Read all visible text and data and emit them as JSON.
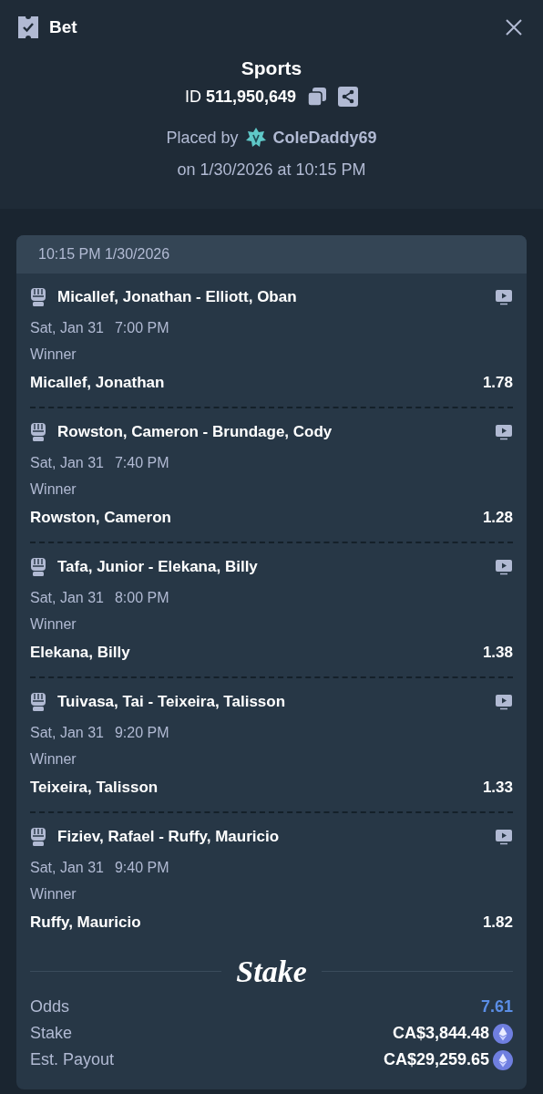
{
  "header": {
    "title": "Bet"
  },
  "bet": {
    "category": "Sports",
    "id_label": "ID",
    "id": "511,950,649",
    "placed_by": "Placed by",
    "user": "ColeDaddy69",
    "placed_on": "on 1/30/2026 at 10:15 PM"
  },
  "slip": {
    "timestamp": "10:15 PM 1/30/2026",
    "legs": [
      {
        "event": "Micallef, Jonathan - Elliott, Oban",
        "date": "Sat, Jan 31",
        "time": "7:00 PM",
        "market": "Winner",
        "selection": "Micallef, Jonathan",
        "odds": "1.78"
      },
      {
        "event": "Rowston, Cameron - Brundage, Cody",
        "date": "Sat, Jan 31",
        "time": "7:40 PM",
        "market": "Winner",
        "selection": "Rowston, Cameron",
        "odds": "1.28"
      },
      {
        "event": "Tafa, Junior - Elekana, Billy",
        "date": "Sat, Jan 31",
        "time": "8:00 PM",
        "market": "Winner",
        "selection": "Elekana, Billy",
        "odds": "1.38"
      },
      {
        "event": "Tuivasa, Tai - Teixeira, Talisson",
        "date": "Sat, Jan 31",
        "time": "9:20 PM",
        "market": "Winner",
        "selection": "Teixeira, Talisson",
        "odds": "1.33"
      },
      {
        "event": "Fiziev, Rafael - Ruffy, Mauricio",
        "date": "Sat, Jan 31",
        "time": "9:40 PM",
        "market": "Winner",
        "selection": "Ruffy, Mauricio",
        "odds": "1.82"
      }
    ],
    "logo": "Stake",
    "summary": [
      {
        "kind": "odds",
        "label": "Odds",
        "value": "7.61"
      },
      {
        "kind": "amount",
        "label": "Stake",
        "value": "CA$3,844.48"
      },
      {
        "kind": "amount",
        "label": "Est. Payout",
        "value": "CA$29,259.65"
      }
    ]
  }
}
